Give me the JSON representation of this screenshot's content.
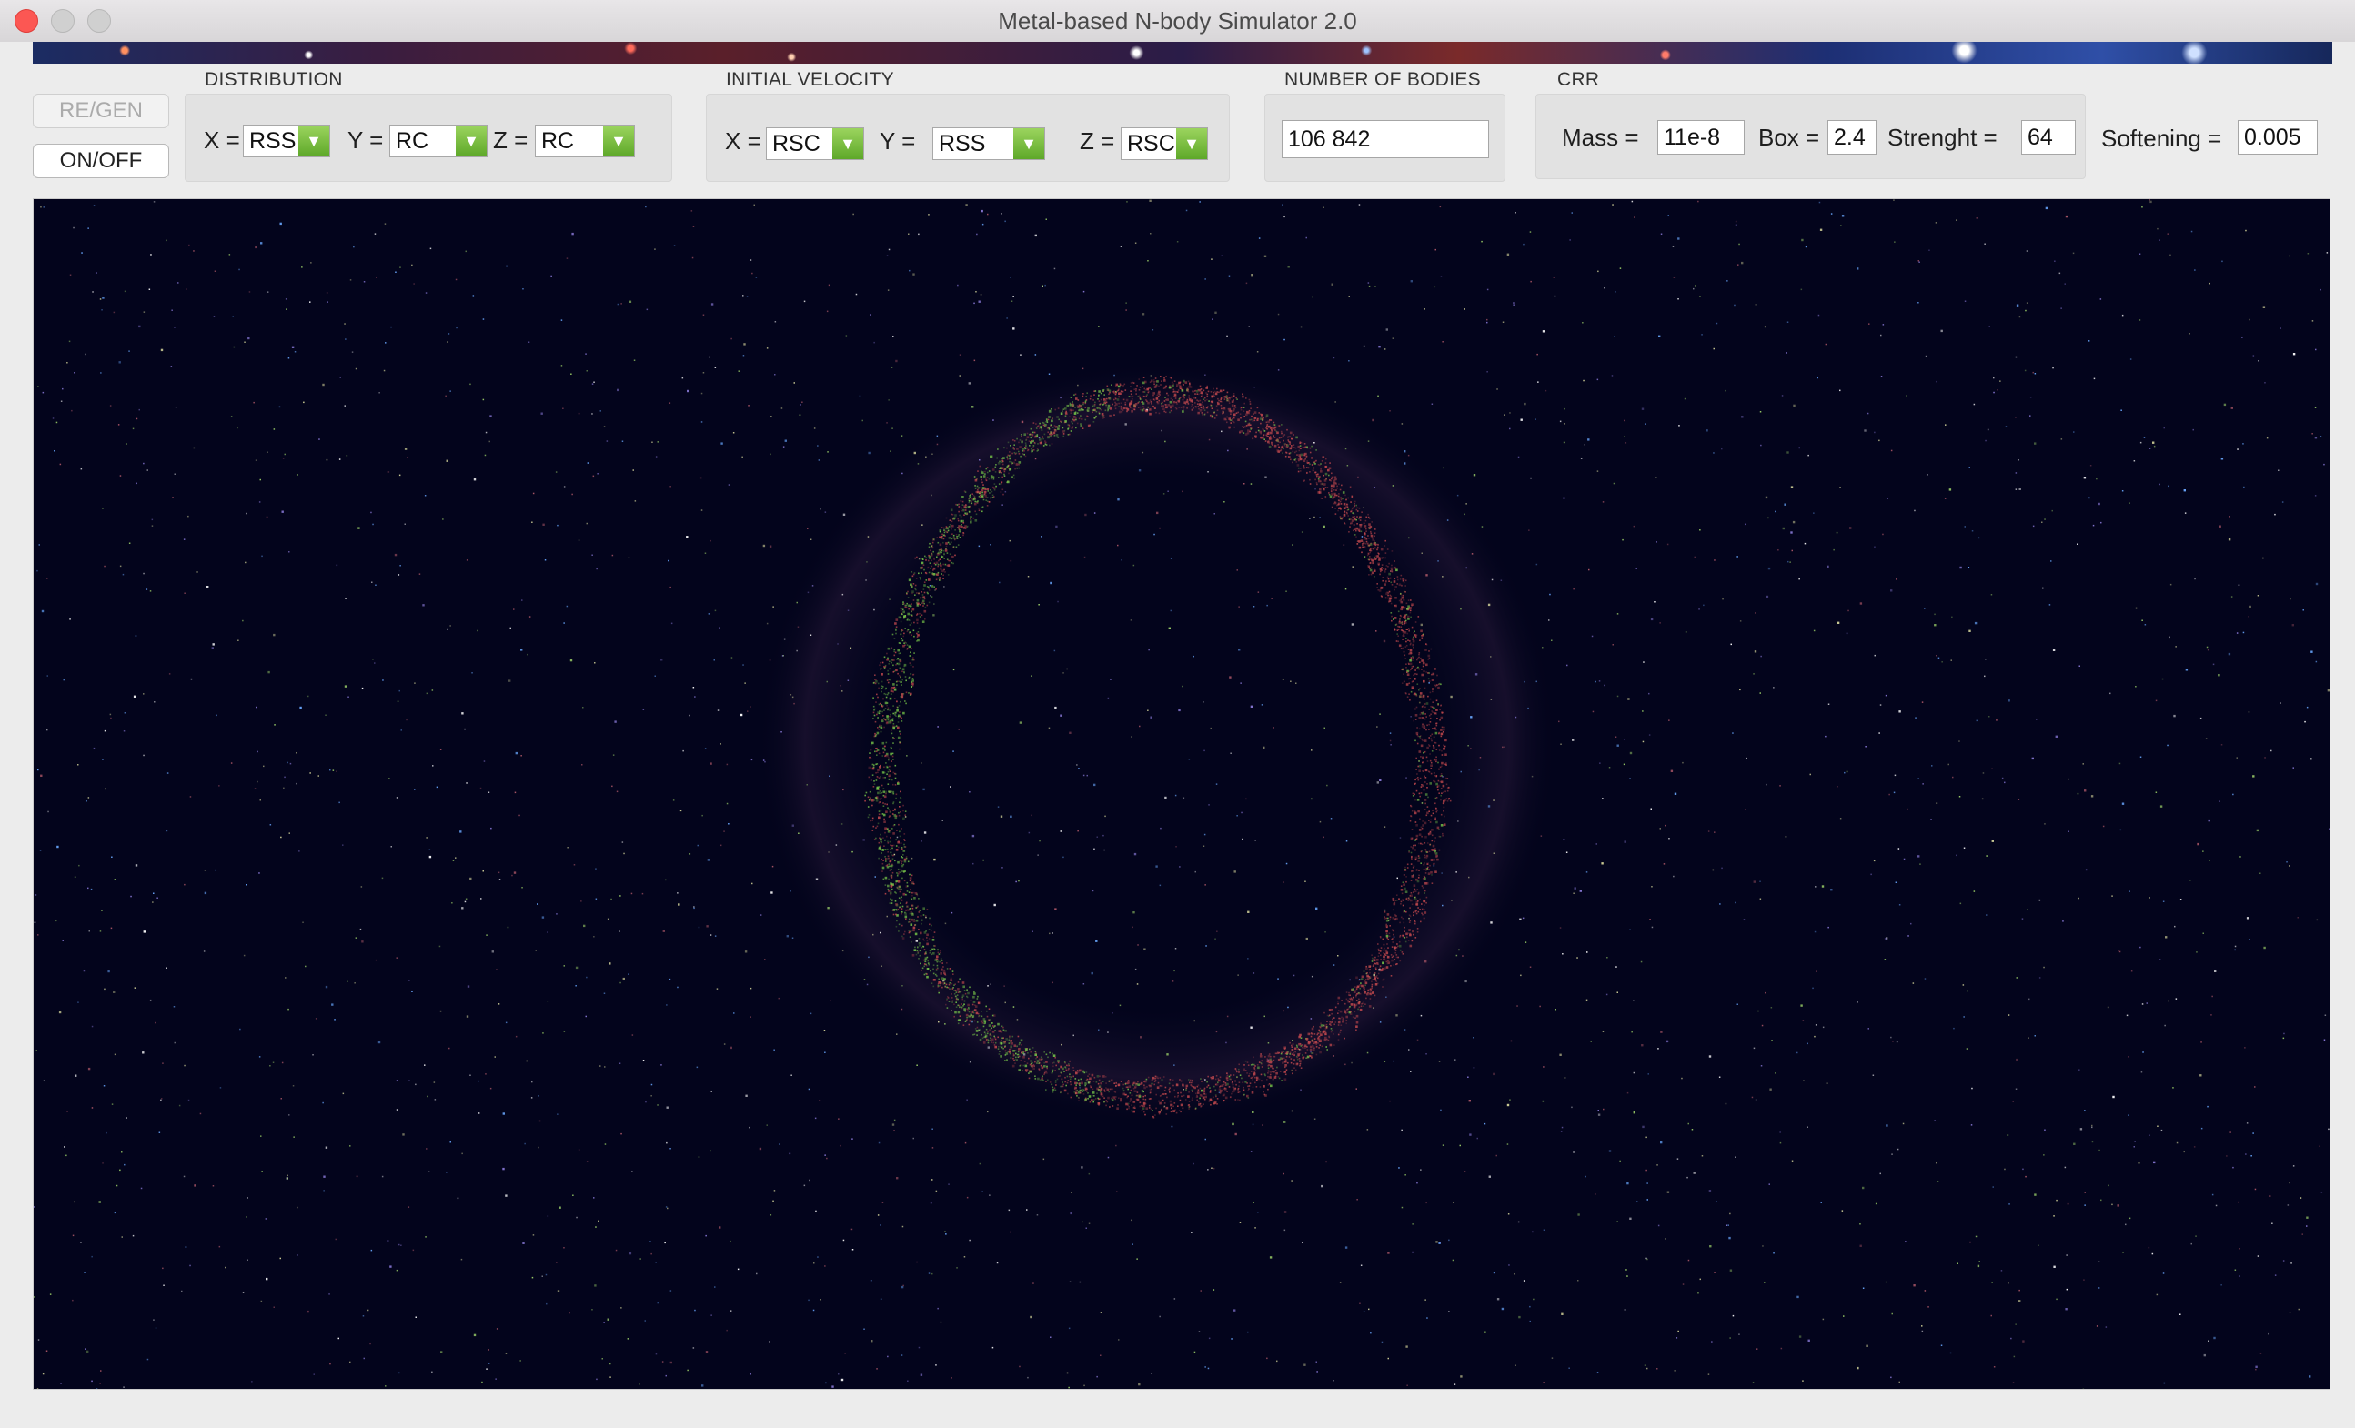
{
  "window": {
    "title": "Metal-based N-body Simulator 2.0"
  },
  "controls": {
    "regen_label": "RE/GEN",
    "onoff_label": "ON/OFF"
  },
  "distribution": {
    "title": "DISTRIBUTION",
    "x_label": "X =",
    "x_value": "RSS",
    "y_label": "Y =",
    "y_value": "RC",
    "z_label": "Z =",
    "z_value": "RC"
  },
  "initial_velocity": {
    "title": "INITIAL VELOCITY",
    "x_label": "X =",
    "x_value": "RSC",
    "y_label": "Y =",
    "y_value": "RSS",
    "z_label": "Z =",
    "z_value": "RSC"
  },
  "bodies": {
    "title": "NUMBER OF BODIES",
    "value": "106 842"
  },
  "crr": {
    "title": "CRR",
    "mass_label": "Mass =",
    "mass_value": "11e-8",
    "box_label": "Box =",
    "box_value": "2.4",
    "strength_label": "Strenght =",
    "strength_value": "64",
    "softening_label": "Softening =",
    "softening_value": "0.005"
  },
  "icons": {
    "dropdown": "chevron-down-icon"
  },
  "colors": {
    "canvas_background": "#03041c",
    "ring_red": "#c84b4f",
    "ring_green": "#7acb4a",
    "dropdown_accent": "#6bb52f"
  }
}
